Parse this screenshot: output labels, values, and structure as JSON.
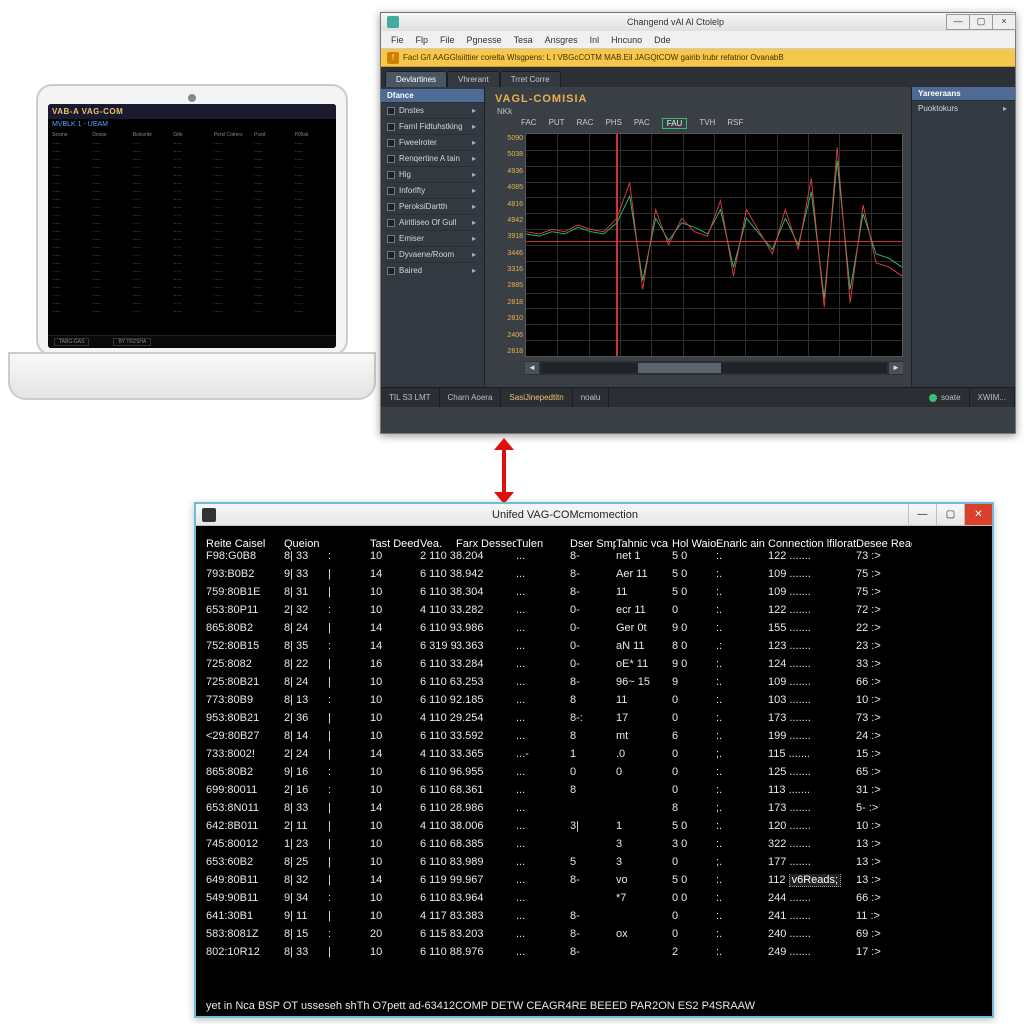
{
  "laptop": {
    "title": "VAB-A VAG-COM",
    "subtitle": "MVBLK 1 - UEAM",
    "headers": [
      "Sesme",
      "Desse",
      "Bslovrite",
      "Gtfe",
      "Persl Colrers",
      "Pced",
      "P05sk"
    ],
    "foot_left": "TABG-GAS",
    "foot_right": "BY  TRZSHA",
    "rows": 22
  },
  "diag": {
    "window_title": "Changend vAl Al Ctolelp",
    "menu": [
      "Fie",
      "Flp",
      "File",
      "Pgnesse",
      "Tesa",
      "Ansgres",
      "Inl",
      "Hncuno",
      "Dde"
    ],
    "banner": "Facl G/I AAGGlsiittier corelta Wlsgpens: L I VBGcCOTM MAB.Eil JAGQtCOW gairib lrubr refatrior OvanabB",
    "tabs": [
      "Devlartines",
      "Vhrerant",
      "Trret Corre"
    ],
    "active_tab": 0,
    "sidebar_header": "Dfance",
    "sidebar": [
      "Dnstes",
      "Farnl Fidtuhstking",
      "Fweelroter",
      "Renqertine A tain",
      "Hig",
      "Inforlfty",
      "PeroksiDartth",
      "Airitliseo Of Gull",
      "Emiser",
      "Dyvaene/Room",
      "Baired"
    ],
    "plot_title": "VAGL-COMISIA",
    "plot_sub": "NKk",
    "col_tabs": [
      "FAC",
      "PUT",
      "RAC",
      "PHS",
      "PAC",
      "FAU",
      "TVH",
      "RSF"
    ],
    "col_active": 5,
    "right_header": "Yareeraans",
    "right_item": "Puoktokurs",
    "status": {
      "left": "TIL S3 LMT",
      "a": "Charn Aoera",
      "b": "SasiJinepedtitn",
      "c": "noalu",
      "right": "soate",
      "right2": "XWIM..."
    }
  },
  "chart_data": {
    "type": "line",
    "title": "VAGL-COMISIA",
    "xlabel": "",
    "ylabel": "",
    "ylim": [
      2818,
      5090
    ],
    "y_ticks": [
      5090,
      5038,
      4936,
      4085,
      4816,
      4942,
      3918,
      3446,
      3316,
      2885,
      2818,
      2810,
      2406,
      2818
    ],
    "x": [
      0,
      1,
      2,
      3,
      4,
      5,
      6,
      7,
      8,
      9,
      10,
      11,
      12,
      13,
      14,
      15,
      16,
      17,
      18,
      19,
      20,
      21,
      22,
      23,
      24,
      25,
      26,
      27,
      28,
      29
    ],
    "series": [
      {
        "name": "green",
        "color": "#2cc06c",
        "values": [
          0.55,
          0.54,
          0.56,
          0.55,
          0.58,
          0.56,
          0.55,
          0.6,
          0.72,
          0.34,
          0.62,
          0.52,
          0.6,
          0.58,
          0.55,
          0.66,
          0.4,
          0.62,
          0.55,
          0.48,
          0.62,
          0.5,
          0.74,
          0.26,
          0.88,
          0.3,
          0.64,
          0.46,
          0.44,
          0.4
        ]
      },
      {
        "name": "red",
        "color": "#e24040",
        "values": [
          0.56,
          0.55,
          0.57,
          0.56,
          0.59,
          0.57,
          0.56,
          0.62,
          0.78,
          0.3,
          0.66,
          0.5,
          0.62,
          0.56,
          0.54,
          0.7,
          0.36,
          0.66,
          0.56,
          0.46,
          0.66,
          0.48,
          0.8,
          0.22,
          0.94,
          0.24,
          0.68,
          0.42,
          0.4,
          0.36
        ]
      }
    ],
    "crosshair": {
      "x_frac": 0.24,
      "y_frac": 0.48
    }
  },
  "console": {
    "title": "Unifed VAG-COMcmomection",
    "headers": [
      "Reite Caisel",
      "Queion",
      "Tast Deed",
      "Vea.",
      "Farx Dessed",
      "Tulen",
      "Dser Smpec",
      "Tahnic vca",
      "Hol Waio",
      "Enarlc ain",
      "Connection lfilorater",
      "Desee Ready"
    ],
    "rows": [
      [
        "F98:G0B8",
        "8|",
        "33",
        ":",
        "10",
        "2  110 3",
        "8.204",
        "...",
        "8-",
        "net   1",
        "5 0",
        ":.",
        "122 .......",
        "73 :>"
      ],
      [
        "793:B0B2",
        "9|",
        "33",
        "|",
        "14",
        "6  110 3",
        "8.942",
        "...",
        "8-",
        "Aer  11",
        "5 0",
        ":.",
        "109 .......",
        "75 :>"
      ],
      [
        "759:80B1E",
        "8|",
        "31",
        "|",
        "10",
        "6  110 3",
        "8.304",
        "...",
        "8-",
        "11",
        "5 0",
        ":.",
        "109 .......",
        "75 :>"
      ],
      [
        "653:80P11",
        "2|",
        "32",
        ":",
        "10",
        "4  110 3",
        "3.282",
        "...",
        "0-",
        "ecr  11",
        "  0",
        ":.",
        "122 .......",
        "72 :>"
      ],
      [
        "865:80B2",
        "8|",
        "24",
        "|",
        "14",
        "6  110 9",
        "3.986",
        "...",
        "0-",
        "Ger  0t",
        "9 0",
        ":.",
        "155 .......",
        "22 :>"
      ],
      [
        "752:80B15",
        "8|",
        "35",
        ":",
        "14",
        "6  319 9",
        "3.363",
        "...",
        "0-",
        "aN  11",
        "8 0",
        ".:",
        "123 .......",
        "23 :>"
      ],
      [
        "725:8082",
        "8|",
        "22",
        "|",
        "16",
        "6  110 3",
        "3.284",
        "...",
        "0-",
        "oE* 11",
        "9 0",
        ":.",
        "124 .......",
        "33 :>"
      ],
      [
        "725:80B21",
        "8|",
        "24",
        "|",
        "10",
        "6  110 6",
        "3.253",
        "...",
        "8-",
        "96~ 15",
        "  9",
        ":.",
        "109 .......",
        "66 :>"
      ],
      [
        "773:80B9",
        "8|",
        "13",
        ":",
        "10",
        "6  110 9",
        "2.185",
        "...",
        "8",
        "   11",
        "  0",
        ":.",
        "103 .......",
        "10 :>"
      ],
      [
        "953:80B21",
        "2|",
        "36",
        "|",
        "10",
        "4  110 2",
        "9.254",
        "...",
        "8-:",
        "17",
        "  0",
        ":.",
        "173 .......",
        "73 :>"
      ],
      [
        "<29:80B27",
        "8|",
        "14",
        "|",
        "10",
        "6  110 3",
        "3.592",
        "...",
        "8",
        "mt",
        "  6",
        ":.",
        "199 .......",
        "24 :>"
      ],
      [
        "733:8002!",
        "2|",
        "24",
        "|",
        "14",
        "4  110 3",
        "3.365",
        "...-",
        "   1",
        ".0",
        "  0",
        ";.",
        "115 .......",
        "15 :>"
      ],
      [
        "865:80B2",
        "9|",
        "16",
        ":",
        "10",
        "6  110 9",
        "6.955",
        "...",
        "0",
        "  0",
        "  0",
        ":.",
        "125 .......",
        "65 :>"
      ],
      [
        "699:80011",
        "2|",
        "16",
        ":",
        "10",
        "6  110 6",
        "8.361",
        "...",
        "8",
        "",
        "  0",
        ":.",
        "113 .......",
        "31 :>"
      ],
      [
        "653:8N011",
        "8|",
        "33",
        "|",
        "14",
        "6  110 2",
        "8.986",
        "...",
        "",
        "",
        "  8",
        ";.",
        "173 .......",
        "5- :>"
      ],
      [
        "642:8B011",
        "2|",
        "11",
        "|",
        "10",
        "4  110 3",
        "8.006",
        "...",
        "3|",
        "1",
        "5 0",
        ":.",
        "120 .......",
        "10 :>"
      ],
      [
        "745:80012",
        "1|",
        "23",
        "|",
        "10",
        "6  110 6",
        "8.385",
        "...",
        "",
        "3",
        "3 0",
        ":.",
        "322 .......",
        "13 :>"
      ],
      [
        "653:60B2",
        "8|",
        "25",
        "|",
        "10",
        "6  110 8",
        "3.989",
        "...",
        "5",
        "3",
        "  0",
        ";.",
        "177 .......",
        "13 :>"
      ],
      [
        "649:80B11",
        "8|",
        "32",
        "|",
        "14",
        "6  119 9",
        "9.967",
        "...",
        "8-",
        "vo",
        "5 0",
        ":.",
        "112 v6Reads;",
        "13 :>"
      ],
      [
        "549:90B11",
        "9|",
        "34",
        ":",
        "10",
        "6  110 8",
        "3.964",
        "...",
        "",
        "*7",
        "0 0",
        ":.",
        "244 .......",
        "66 :>"
      ],
      [
        "641:30B1",
        "9|",
        "11",
        "|",
        "10",
        "4  117 8",
        "3.383",
        "...",
        "8-",
        "",
        "  0",
        ":.",
        "241 .......",
        "11 :>"
      ],
      [
        "583:8081Z",
        "8|",
        "15",
        ":",
        "20",
        "6  115 8",
        "3.203",
        "...",
        "8-",
        "ox",
        "  0",
        ":.",
        "240 .......",
        "69 :>"
      ],
      [
        "802:10R12",
        "8|",
        "33",
        "|",
        "10",
        "6  110 8",
        "8.976",
        "...",
        "8-",
        "",
        "  2",
        ":.",
        "249 .......",
        "17 :>"
      ]
    ],
    "footer": "yet in Nca BSP OT usseseh shTh  O7pett ad-63412COMP DETW CEAGR4RE   BEEED PAR2ON ES2  P4SRAAW"
  }
}
